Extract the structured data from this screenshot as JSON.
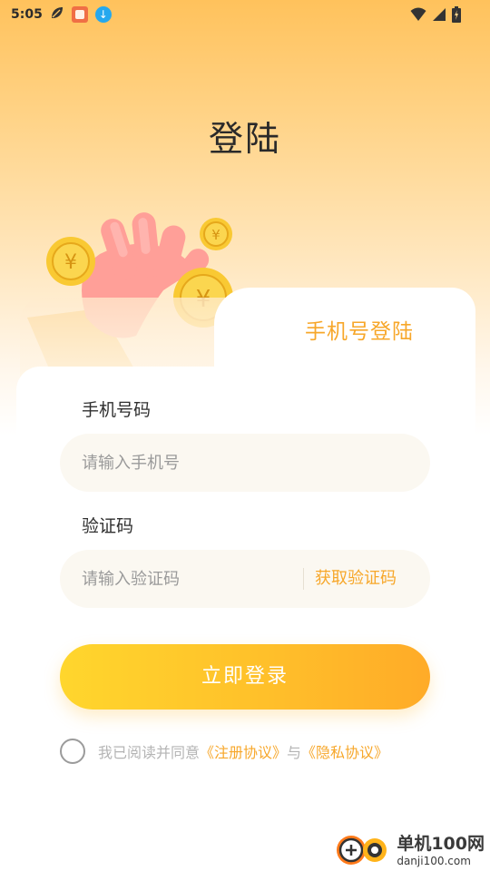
{
  "status_bar": {
    "time": "5:05",
    "left_icons": [
      "leaf-icon",
      "app-notification-icon",
      "download-icon"
    ],
    "right_icons": [
      "wifi-icon",
      "signal-icon",
      "battery-icon"
    ]
  },
  "page": {
    "title": "登陆"
  },
  "card": {
    "tab_label": "手机号登陆"
  },
  "form": {
    "phone": {
      "label": "手机号码",
      "placeholder": "请输入手机号",
      "value": ""
    },
    "code": {
      "label": "验证码",
      "placeholder": "请输入验证码",
      "value": "",
      "get_code_label": "获取验证码"
    },
    "login_label": "立即登录"
  },
  "agreement": {
    "checked": false,
    "prefix": "我已阅读并同意",
    "register_link": "《注册协议》",
    "joiner": "与",
    "privacy_link": "《隐私协议》"
  },
  "watermark": {
    "name": "单机100网",
    "domain": "danji100.com"
  },
  "colors": {
    "accent": "#f7a72a",
    "button_start": "#ffd62d",
    "button_end": "#ffab28",
    "input_bg": "#fbf8f1",
    "header_gradient_top": "#ffc25c"
  }
}
